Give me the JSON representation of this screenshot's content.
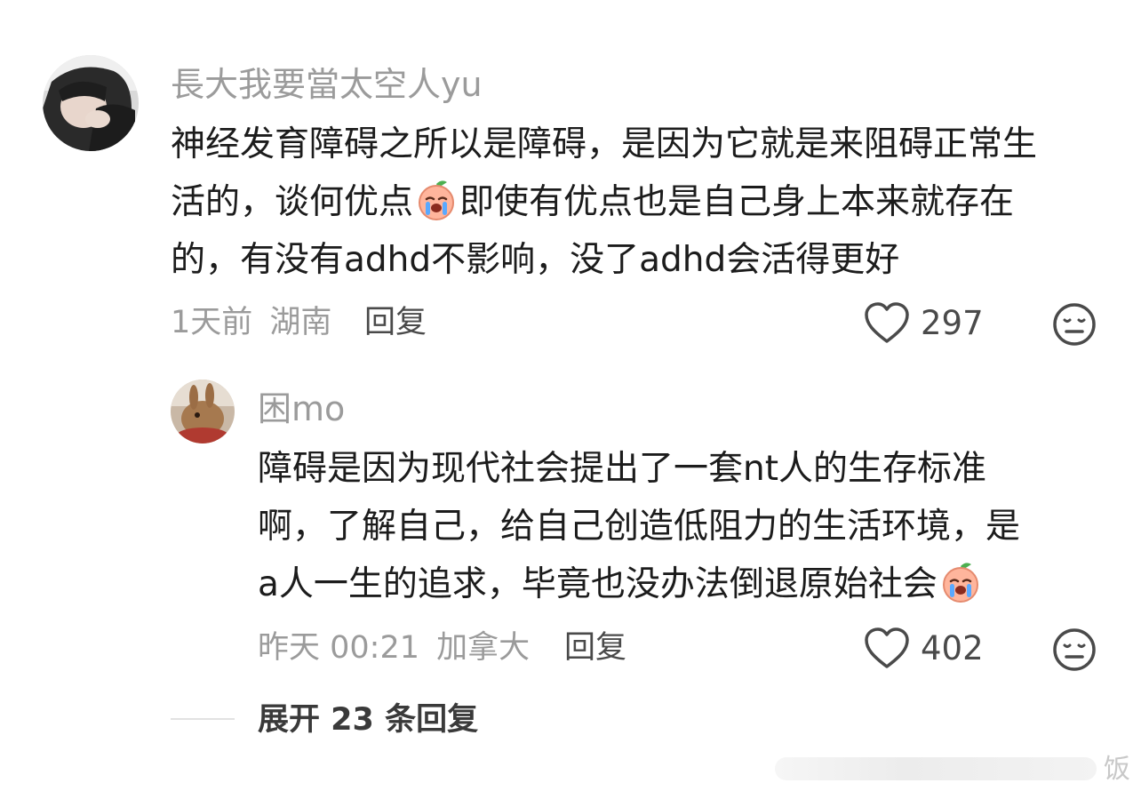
{
  "comments": [
    {
      "username": "長大我要當太空人yu",
      "text_lines": [
        "神经发育障碍之所以是障碍，是因为它就是来阻碍正常生",
        "活的，谈何优点",
        "即使有优点也是自己身上本来就存在",
        "的，有没有adhd不影响，没了adhd会活得更好"
      ],
      "time": "1天前",
      "location": "湖南",
      "reply_label": "回复",
      "likes": "297"
    },
    {
      "username": "困mo",
      "text_lines": [
        "障碍是因为现代社会提出了一套nt人的生存标准",
        "啊，了解自己，给自己创造低阻力的生活环境，是",
        "a人一生的追求，毕竟也没办法倒退原始社会"
      ],
      "time": "昨天 00:21",
      "location": "加拿大",
      "reply_label": "回复",
      "likes": "402"
    }
  ],
  "expand_replies_label": "展开 23 条回复",
  "watermark_text": "饭",
  "icons": {
    "like": "heart-outline-icon",
    "dislike": "neutral-face-icon",
    "emoji": "crying-peach-emoji"
  },
  "colors": {
    "text": "#1c1c1c",
    "muted": "#9b9b9b",
    "action": "#4a4a4a"
  }
}
